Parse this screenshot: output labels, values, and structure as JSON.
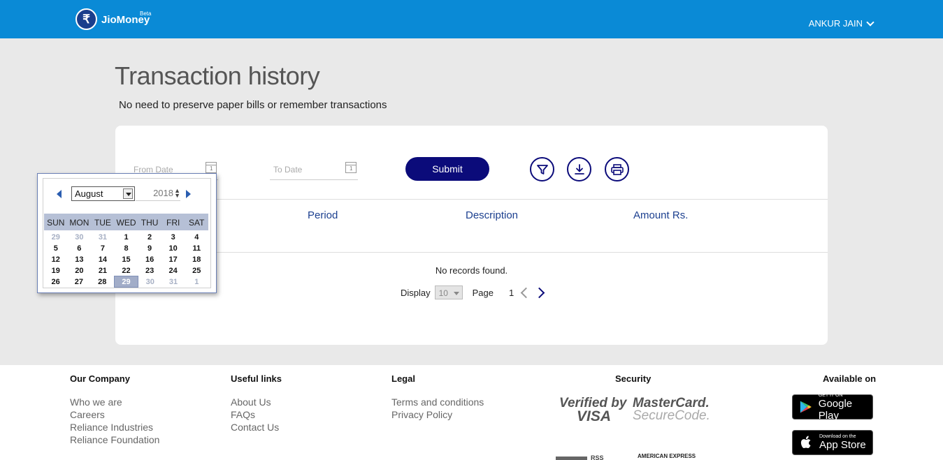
{
  "header": {
    "brand": "JioMoney",
    "beta": "Beta",
    "user_name": "ANKUR JAIN",
    "colors": {
      "topbar": "#0a8ad6",
      "accent": "#0b0b7a"
    }
  },
  "page": {
    "title": "Transaction history",
    "subtitle": "No need to preserve paper bills or remember transactions"
  },
  "filters": {
    "from_date_placeholder": "From Date",
    "to_date_placeholder": "To Date",
    "submit_label": "Submit",
    "icons": [
      "filter-icon",
      "download-icon",
      "print-icon"
    ]
  },
  "table": {
    "columns": [
      "Period",
      "Description",
      "Amount Rs."
    ],
    "empty_message": "No records found."
  },
  "pager": {
    "display_label": "Display",
    "page_size": "10",
    "page_label": "Page",
    "current_page": "1"
  },
  "calendar": {
    "month": "August",
    "year": "2018",
    "weekdays": [
      "SUN",
      "MON",
      "TUE",
      "WED",
      "THU",
      "FRI",
      "SAT"
    ],
    "weeks": [
      [
        "29",
        "30",
        "31",
        "1",
        "2",
        "3",
        "4"
      ],
      [
        "5",
        "6",
        "7",
        "8",
        "9",
        "10",
        "11"
      ],
      [
        "12",
        "13",
        "14",
        "15",
        "16",
        "17",
        "18"
      ],
      [
        "19",
        "20",
        "21",
        "22",
        "23",
        "24",
        "25"
      ],
      [
        "26",
        "27",
        "28",
        "29",
        "30",
        "31",
        "1"
      ]
    ],
    "selected_day": "29"
  },
  "footer": {
    "our_company": {
      "heading": "Our Company",
      "links": [
        "Who we are",
        "Careers",
        "Reliance Industries",
        "Reliance Foundation"
      ]
    },
    "useful_links": {
      "heading": "Useful links",
      "links": [
        "About Us",
        "FAQs",
        "Contact Us"
      ]
    },
    "legal": {
      "heading": "Legal",
      "links": [
        "Terms and conditions",
        "Privacy Policy"
      ]
    },
    "security": {
      "heading": "Security",
      "verified_by": "Verified by",
      "visa": "VISA",
      "mastercard": "MasterCard.",
      "securecode": "SecureCode.",
      "american_express": "AMERICAN EXPRESS"
    },
    "available_on": {
      "heading": "Available on",
      "google_small": "GET IT ON",
      "google_big": "Google Play",
      "apple_small": "Download on the",
      "apple_big": "App Store"
    }
  }
}
